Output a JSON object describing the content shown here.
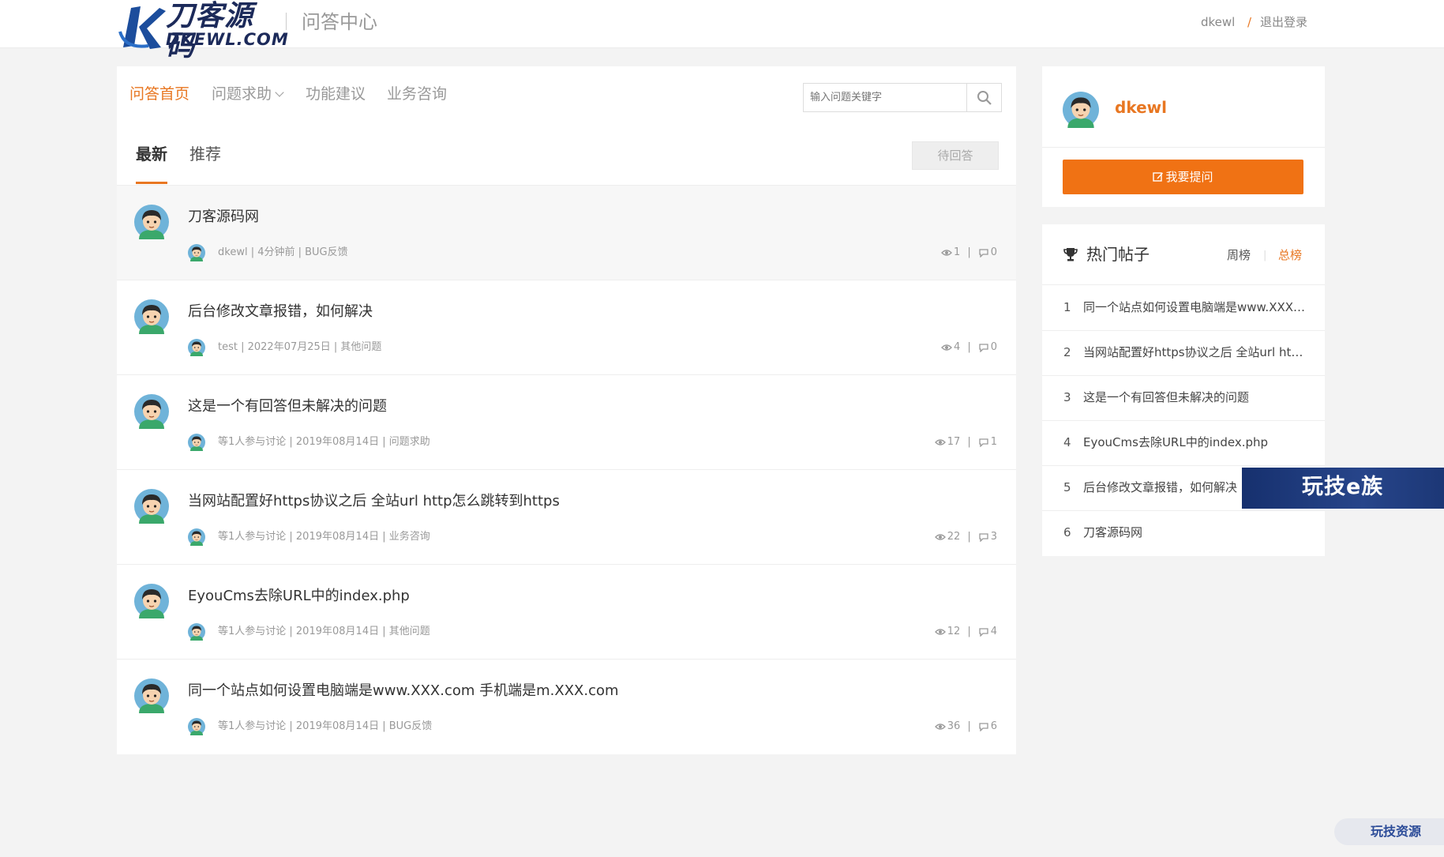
{
  "header": {
    "logo_text_cn": "刀客源码",
    "logo_text_en": "DKEWL.COM",
    "section_title": "问答中心",
    "username": "dkewl",
    "separator": "/",
    "logout_label": "退出登录"
  },
  "nav": {
    "items": [
      {
        "label": "问答首页"
      },
      {
        "label": "问题求助"
      },
      {
        "label": "功能建议"
      },
      {
        "label": "业务咨询"
      }
    ]
  },
  "search": {
    "placeholder": "输入问题关键字"
  },
  "tabs": {
    "latest": "最新",
    "recommended": "推荐",
    "pending_button": "待回答"
  },
  "questions": [
    {
      "title": "刀客源码网",
      "meta": "dkewl | 4分钟前 | BUG反馈",
      "views": "1",
      "answers": "0"
    },
    {
      "title": "后台修改文章报错，如何解决",
      "meta": "test | 2022年07月25日 | 其他问题",
      "views": "4",
      "answers": "0"
    },
    {
      "title": "这是一个有回答但未解决的问题",
      "meta": "等1人参与讨论 | 2019年08月14日 | 问题求助",
      "views": "17",
      "answers": "1"
    },
    {
      "title": "当网站配置好https协议之后 全站url http怎么跳转到https",
      "meta": "等1人参与讨论 | 2019年08月14日 | 业务咨询",
      "views": "22",
      "answers": "3"
    },
    {
      "title": "EyouCms去除URL中的index.php",
      "meta": "等1人参与讨论 | 2019年08月14日 | 其他问题",
      "views": "12",
      "answers": "4"
    },
    {
      "title": "同一个站点如何设置电脑端是www.XXX.com 手机端是m.XXX.com",
      "meta": "等1人参与讨论 | 2019年08月14日 | BUG反馈",
      "views": "36",
      "answers": "6"
    }
  ],
  "sidebar": {
    "username": "dkewl",
    "ask_button": "我要提问",
    "hot": {
      "title": "热门帖子",
      "week_label": "周榜",
      "divider": "|",
      "all_label": "总榜",
      "items": [
        {
          "rank": "1",
          "text": "同一个站点如何设置电脑端是www.XXX.com 手机端是m.XXX.com"
        },
        {
          "rank": "2",
          "text": "当网站配置好https协议之后 全站url http怎么跳转到https"
        },
        {
          "rank": "3",
          "text": "这是一个有回答但未解决的问题"
        },
        {
          "rank": "4",
          "text": "EyouCms去除URL中的index.php"
        },
        {
          "rank": "5",
          "text": "后台修改文章报错，如何解决"
        },
        {
          "rank": "6",
          "text": "刀客源码网"
        }
      ]
    }
  },
  "watermarks": {
    "band": "玩技e族",
    "corner": "玩技资源"
  },
  "colors": {
    "accent": "#e87722",
    "button": "#f07214",
    "background": "#f3f3f3"
  }
}
